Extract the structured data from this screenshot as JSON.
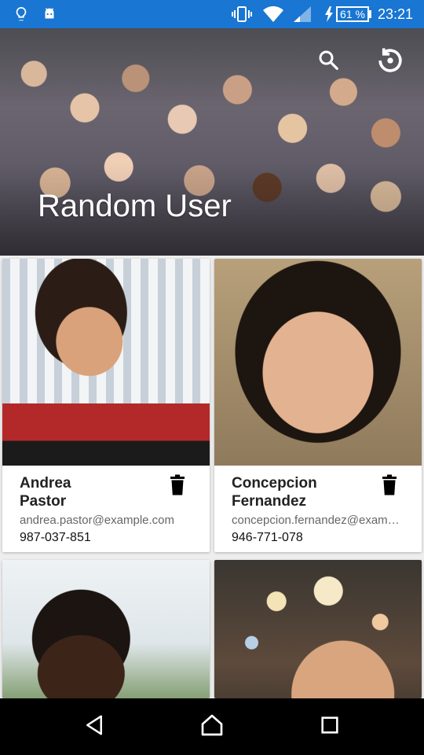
{
  "status_bar": {
    "battery_percent": "61 %",
    "time": "23:21",
    "icons": [
      "lightbulb-icon",
      "android-icon",
      "vibrate-icon",
      "wifi-icon",
      "signal-icon",
      "charging-bolt-icon",
      "battery-icon"
    ]
  },
  "header": {
    "title": "Random User",
    "actions": [
      "search-icon",
      "restore-icon"
    ]
  },
  "users": [
    {
      "first": "Andrea",
      "last": "Pastor",
      "email": "andrea.pastor@example.com",
      "phone": "987-037-851"
    },
    {
      "first": "Concepcion",
      "last": "Fernandez",
      "email": "concepcion.fernandez@exam…",
      "phone": "946-771-078"
    },
    {
      "first": "",
      "last": "",
      "email": "",
      "phone": ""
    },
    {
      "first": "",
      "last": "",
      "email": "",
      "phone": ""
    }
  ],
  "nav": [
    "back-icon",
    "home-icon",
    "recents-icon"
  ],
  "colors": {
    "status_bar": "#1976d2",
    "background": "#eeeeee"
  }
}
